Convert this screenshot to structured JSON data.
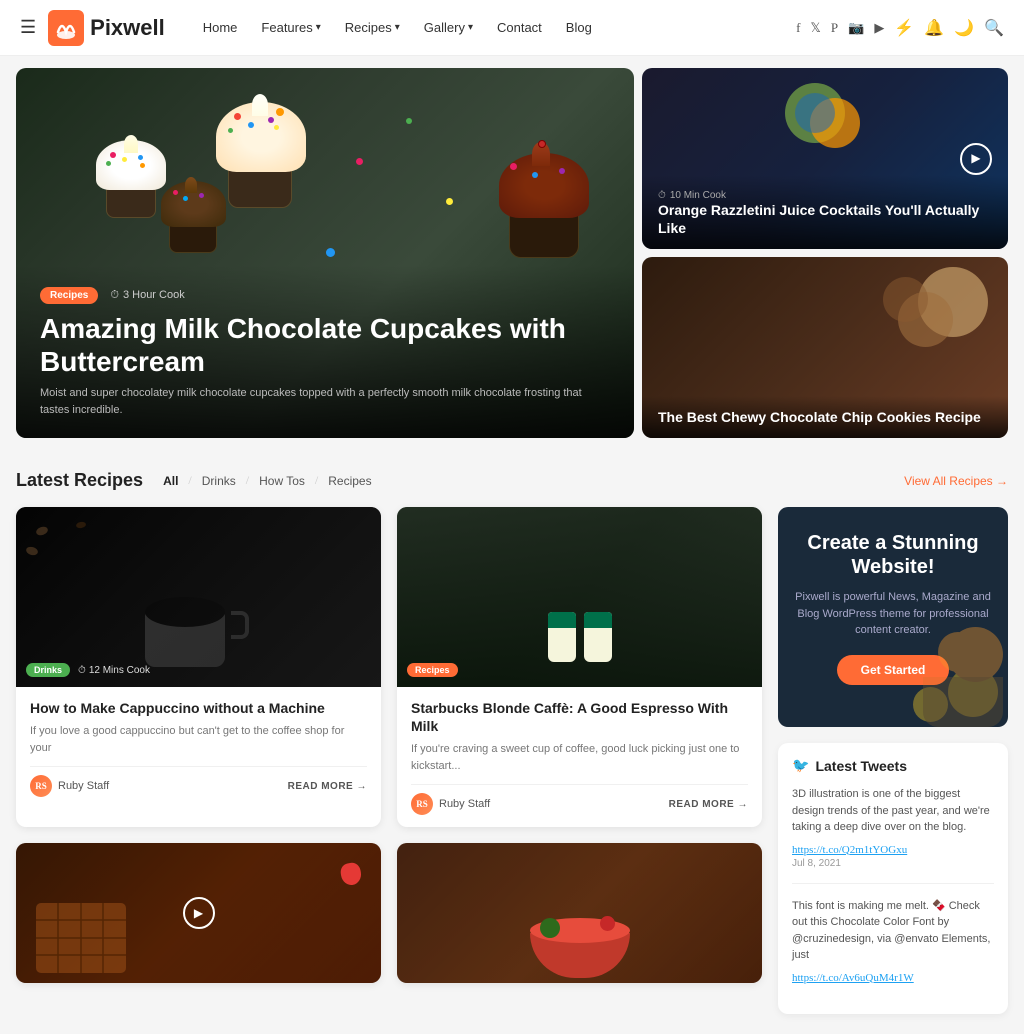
{
  "brand": {
    "name": "Pixwell",
    "logo_alt": "Pixwell Logo"
  },
  "navbar": {
    "hamburger_label": "☰",
    "nav_items": [
      {
        "label": "Home",
        "has_dropdown": false
      },
      {
        "label": "Features",
        "has_dropdown": true
      },
      {
        "label": "Recipes",
        "has_dropdown": true
      },
      {
        "label": "Gallery",
        "has_dropdown": true
      },
      {
        "label": "Contact",
        "has_dropdown": false
      },
      {
        "label": "Blog",
        "has_dropdown": false
      }
    ],
    "social_icons": [
      "f",
      "t",
      "p",
      "ig",
      "yt"
    ],
    "action_icons": [
      "⚡",
      "🔔",
      "🌙",
      "🔍"
    ]
  },
  "hero": {
    "main_card": {
      "badge": "Recipes",
      "cook_time": "3 Hour Cook",
      "title": "Amazing Milk Chocolate Cupcakes with Buttercream",
      "description": "Moist and super chocolatey milk chocolate cupcakes topped with a perfectly smooth milk chocolate frosting that tastes incredible."
    },
    "side_cards": [
      {
        "title": "Orange Razzletini Juice Cocktails You'll Actually Like",
        "cook_time": "10 Min Cook",
        "has_play": true
      },
      {
        "title": "The Best Chewy Chocolate Chip Cookies Recipe",
        "cook_time": "",
        "has_play": false
      }
    ]
  },
  "latest_recipes": {
    "section_title": "Latest Recipes",
    "filter_tabs": [
      "All",
      "Drinks",
      "How Tos",
      "Recipes"
    ],
    "active_tab": "All",
    "view_all_label": "View All Recipes →",
    "cards": [
      {
        "badge": "Drinks",
        "badge_color": "green",
        "cook_time": "12 Mins Cook",
        "title": "How to Make Cappuccino without a Machine",
        "description": "If you love a good cappuccino but can't get to the coffee shop for your",
        "author": "Ruby Staff",
        "read_more": "READ MORE →",
        "has_play": false
      },
      {
        "badge": "Recipes",
        "badge_color": "orange",
        "cook_time": "",
        "title": "Starbucks Blonde Caffè: A Good Espresso With Milk",
        "description": "If you're craving a sweet cup of coffee, good luck picking just one to kickstart...",
        "author": "Ruby Staff",
        "read_more": "READ MORE →",
        "has_play": false
      },
      {
        "badge": "",
        "badge_color": "",
        "cook_time": "",
        "title": "",
        "description": "",
        "author": "",
        "read_more": "",
        "has_play": true
      },
      {
        "badge": "",
        "badge_color": "",
        "cook_time": "",
        "title": "",
        "description": "",
        "author": "",
        "read_more": "",
        "has_play": false
      }
    ]
  },
  "promo": {
    "title": "Create a Stunning Website!",
    "description": "Pixwell is powerful News, Magazine and Blog WordPress theme for professional content creator.",
    "button_label": "Get Started"
  },
  "latest_tweets": {
    "section_title": "Latest Tweets",
    "twitter_icon": "🐦",
    "tweets": [
      {
        "text": "3D illustration is one of the biggest design trends of the past year, and we're taking a deep dive over on the blog.",
        "link": "https://t.co/Q2m1tYOGxu",
        "date": "Jul 8, 2021"
      },
      {
        "text": "This font is making me melt. 🍫 Check out this Chocolate Color Font by @cruzinedesign, via @envato Elements, just",
        "link": "https://t.co/Av6uQuM4r1W",
        "date": ""
      }
    ]
  }
}
